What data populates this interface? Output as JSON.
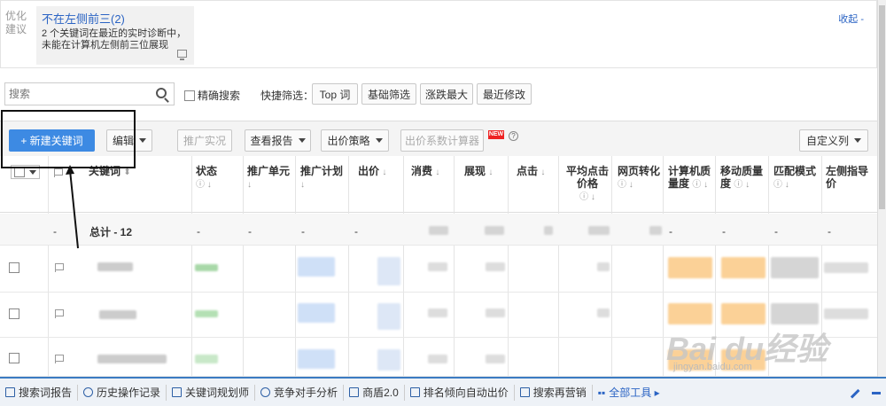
{
  "suggestion": {
    "label": "优化建议",
    "title": "不在左侧前三(2)",
    "desc": "2 个关键词在最近的实时诊断中，未能在计算机左侧前三位展现",
    "collapse": "收起 -"
  },
  "search": {
    "placeholder": "搜索",
    "exact_label": "精确搜索",
    "quick_filter_label": "快捷筛选：",
    "quick_filters": [
      "Top 词",
      "基础筛选",
      "涨跌最大",
      "最近修改"
    ]
  },
  "toolbar": {
    "new_keyword": "+ 新建关键词",
    "edit": "编辑",
    "promo_status": "推广实况",
    "view_report": "查看报告",
    "bid_strategy": "出价策略",
    "bid_calc": "出价系数计算器",
    "new_badge": "NEW",
    "custom_cols": "自定义列"
  },
  "table": {
    "headers": [
      "关键词",
      "状态",
      "推广单元",
      "推广计划",
      "出价",
      "消费",
      "展现",
      "点击",
      "平均点击价格",
      "网页转化",
      "计算机质量度",
      "移动质量度",
      "匹配模式",
      "左侧指导价"
    ],
    "total_label": "总计 - 12",
    "dash": "-"
  },
  "bottom_bar": {
    "items": [
      "搜索词报告",
      "历史操作记录",
      "关键词规划师",
      "竞争对手分析",
      "商盾2.0",
      "排名倾向自动出价",
      "搜索再营销"
    ],
    "all_tools": "全部工具 ▸"
  },
  "watermark": {
    "text": "Bai du经验",
    "url": "jingyan.baidu.com"
  },
  "colors": {
    "primary": "#3d8ae3",
    "link": "#2b64c4"
  }
}
